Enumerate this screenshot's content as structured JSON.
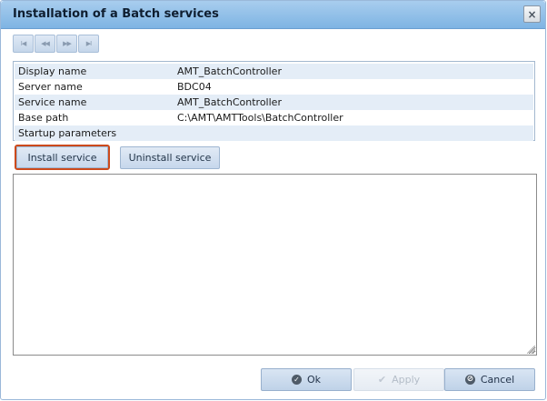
{
  "dialog": {
    "title": "Installation of a Batch services",
    "close_icon": "×"
  },
  "nav": {
    "first": "I◀",
    "prev": "◀◀",
    "next": "▶▶",
    "last": "▶I"
  },
  "properties": [
    {
      "label": "Display name",
      "value": "AMT_BatchController"
    },
    {
      "label": "Server name",
      "value": "BDC04"
    },
    {
      "label": "Service name",
      "value": "AMT_BatchController"
    },
    {
      "label": "Base path",
      "value": "C:\\AMT\\AMTTools\\BatchController"
    },
    {
      "label": "Startup parameters",
      "value": ""
    }
  ],
  "actions": {
    "install_label": "Install service",
    "uninstall_label": "Uninstall service"
  },
  "output": {
    "text": ""
  },
  "footer": {
    "ok_label": "Ok",
    "apply_label": "Apply",
    "cancel_label": "Cancel",
    "ok_icon": "✓",
    "apply_icon": "✔",
    "cancel_icon": "⊘"
  },
  "colors": {
    "titlebar": "#7eb4e3",
    "highlight_border": "#cc4a1c",
    "row_alt": "#e4edf7"
  }
}
